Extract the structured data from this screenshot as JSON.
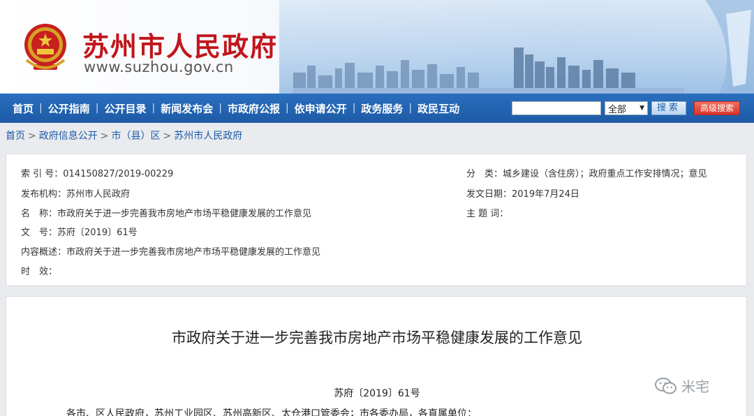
{
  "header": {
    "site_title": "苏州市人民政府",
    "site_url": "www.suzhou.gov.cn"
  },
  "nav": {
    "items": [
      "首页",
      "公开指南",
      "公开目录",
      "新闻发布会",
      "市政府公报",
      "依申请公开",
      "政务服务",
      "政民互动"
    ],
    "search_scope": "全部",
    "search_label": "搜索",
    "advanced_search_label": "高级搜索"
  },
  "breadcrumb": [
    "首页",
    "政府信息公开",
    "市（县）区",
    "苏州市人民政府"
  ],
  "info": {
    "index_label": "索 引 号：",
    "index_value": "014150827/2019-00229",
    "publisher_label": "发布机构：",
    "publisher_value": "苏州市人民政府",
    "name_label": "名　称：",
    "name_value": "市政府关于进一步完善我市房地产市场平稳健康发展的工作意见",
    "docno_label": "文　号：",
    "docno_value": "苏府〔2019〕61号",
    "summary_label": "内容概述：",
    "summary_value": "市政府关于进一步完善我市房地产市场平稳健康发展的工作意见",
    "validity_label": "时　效：",
    "category_label": "分　类：",
    "category_value": "城乡建设（含住房）；政府重点工作安排情况；意见",
    "date_label": "发文日期：",
    "date_value": "2019年7月24日",
    "keywords_label": "主 题 词："
  },
  "document": {
    "title": "市政府关于进一步完善我市房地产市场平稳健康发展的工作意见",
    "number": "苏府〔2019〕61号",
    "addressee": "各市、区人民政府，苏州工业园区、苏州高新区、太仓港口管委会；市各委办局，各直属单位："
  },
  "watermark": {
    "text": "米宅"
  },
  "colors": {
    "brand_red": "#c0161c",
    "nav_blue": "#1d5aa6",
    "link_blue": "#1e5aa8"
  }
}
